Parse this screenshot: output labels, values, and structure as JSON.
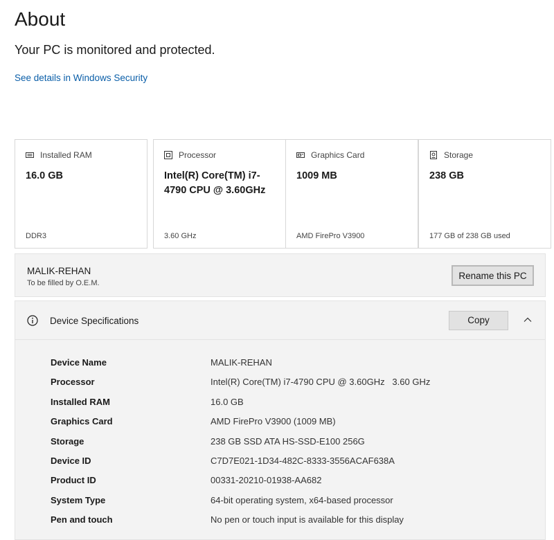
{
  "header": {
    "title": "About",
    "protection_status": "Your PC is monitored and protected.",
    "security_link": "See details in Windows Security"
  },
  "cards": [
    {
      "icon": "ram-icon",
      "label": "Installed RAM",
      "value": "16.0 GB",
      "sub": "DDR3"
    },
    {
      "icon": "processor-icon",
      "label": "Processor",
      "value": "Intel(R) Core(TM) i7-4790 CPU @ 3.60GHz",
      "sub": "3.60 GHz"
    },
    {
      "icon": "graphics-card-icon",
      "label": "Graphics Card",
      "value": "1009 MB",
      "sub": "AMD FirePro V3900"
    },
    {
      "icon": "storage-icon",
      "label": "Storage",
      "value": "238 GB",
      "sub": "177 GB of 238 GB used"
    }
  ],
  "pc": {
    "name": "MALIK-REHAN",
    "subtitle": "To be filled by O.E.M.",
    "rename_label": "Rename this PC"
  },
  "specs": {
    "title": "Device Specifications",
    "copy_label": "Copy",
    "expanded": true,
    "rows": [
      {
        "key": "Device Name",
        "value": "MALIK-REHAN"
      },
      {
        "key": "Processor",
        "value": "Intel(R) Core(TM) i7-4790 CPU @ 3.60GHz   3.60 GHz"
      },
      {
        "key": "Installed RAM",
        "value": "16.0 GB"
      },
      {
        "key": "Graphics Card",
        "value": "AMD FirePro V3900 (1009 MB)"
      },
      {
        "key": "Storage",
        "value": "238 GB SSD ATA HS-SSD-E100 256G"
      },
      {
        "key": "Device ID",
        "value": "C7D7E021-1D34-482C-8333-3556ACAF638A"
      },
      {
        "key": "Product ID",
        "value": "00331-20210-01938-AA682"
      },
      {
        "key": "System Type",
        "value": "64-bit operating system, x64-based processor"
      },
      {
        "key": "Pen and touch",
        "value": "No pen or touch input is available for this display"
      }
    ]
  }
}
